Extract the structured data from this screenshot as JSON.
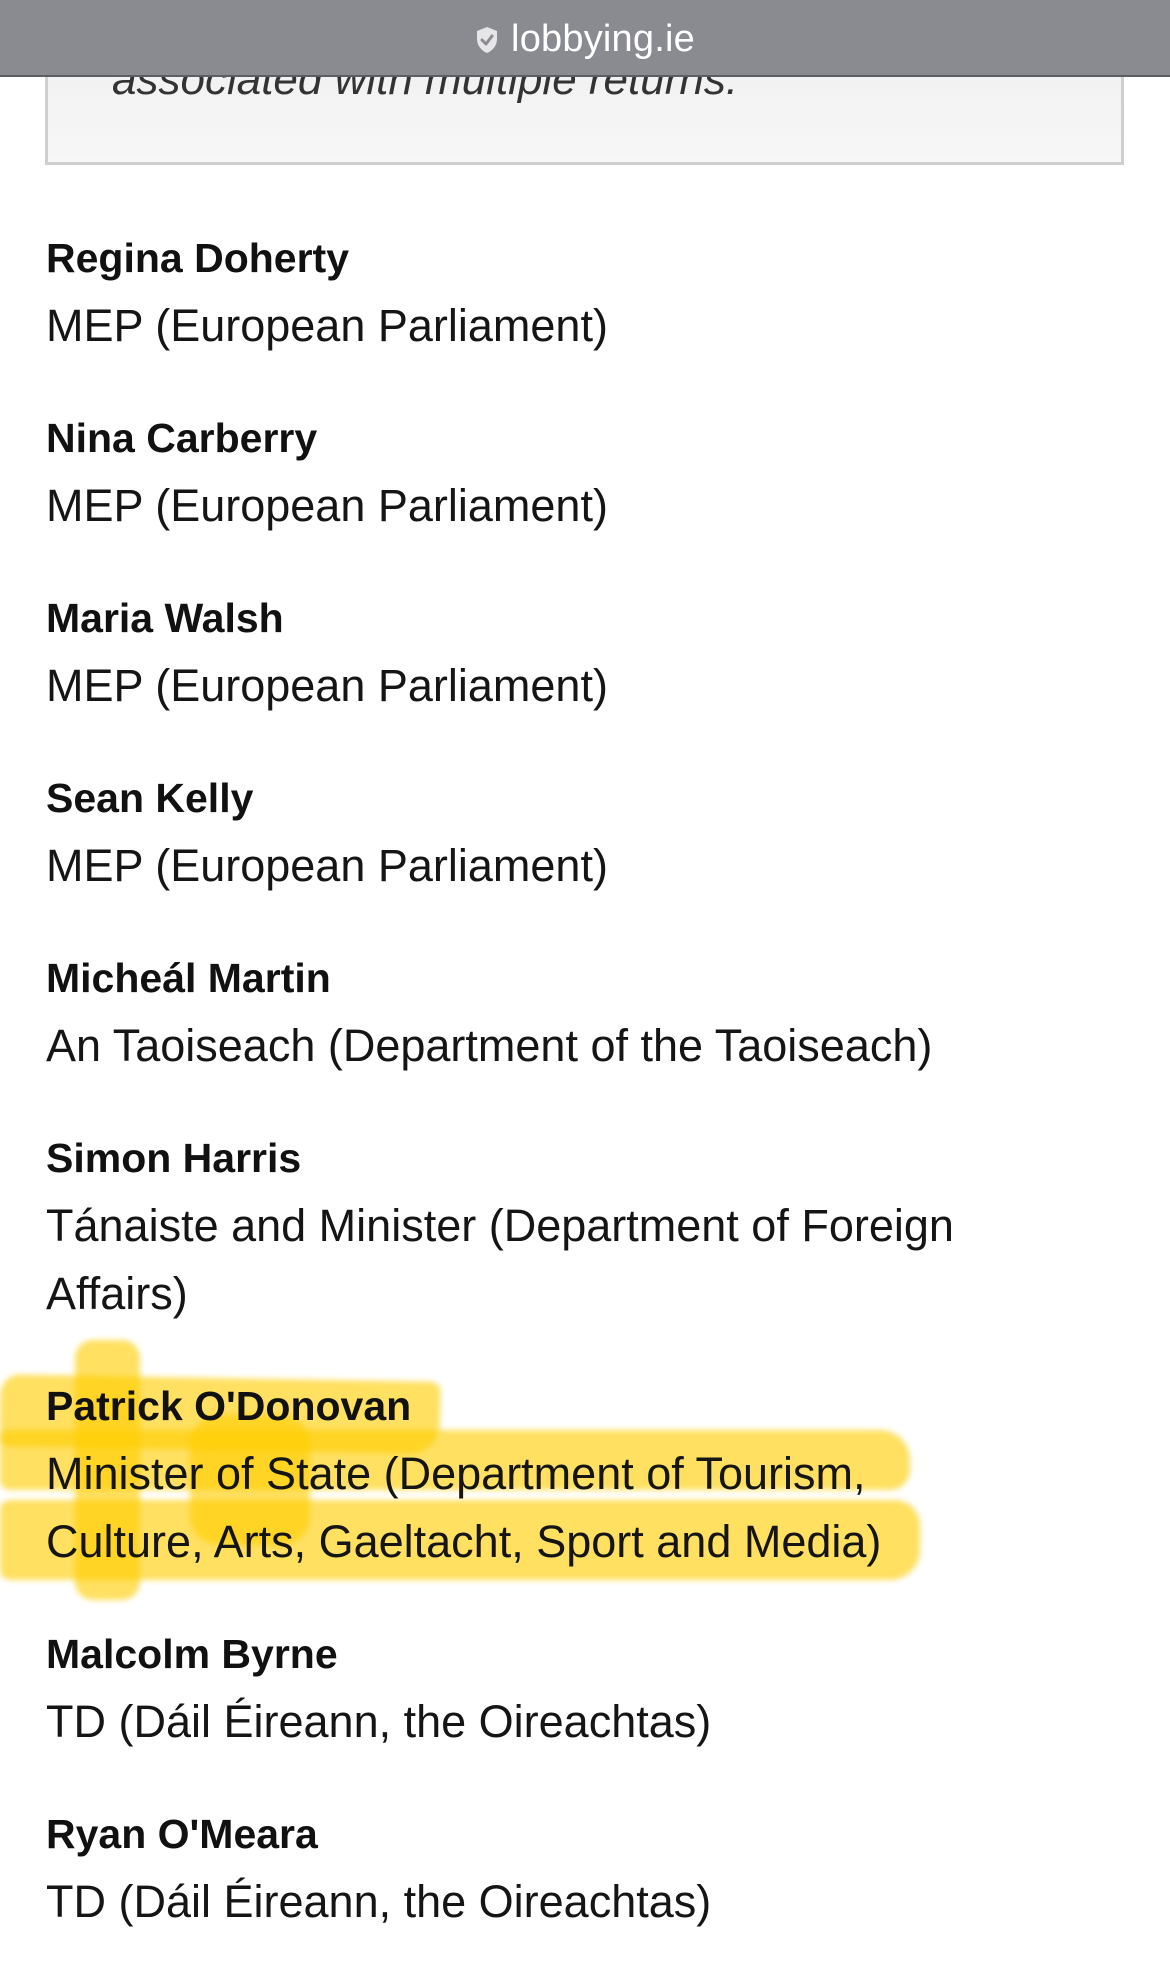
{
  "browser": {
    "domain": "lobbying.ie"
  },
  "notice": {
    "text": "associated with multiple returns."
  },
  "officials": [
    {
      "name": "Regina Doherty",
      "role": "MEP (European Parliament)"
    },
    {
      "name": "Nina Carberry",
      "role": "MEP (European Parliament)"
    },
    {
      "name": "Maria Walsh",
      "role": "MEP (European Parliament)"
    },
    {
      "name": "Sean Kelly",
      "role": "MEP (European Parliament)"
    },
    {
      "name": "Micheál Martin",
      "role": "An Taoiseach (Department of the Taoiseach)"
    },
    {
      "name": "Simon Harris",
      "role": "Tánaiste and Minister (Department of Foreign Affairs)"
    },
    {
      "name": "Patrick O'Donovan",
      "role": "Minister of State (Department of Tourism, Culture, Arts, Gaeltacht, Sport and Media)"
    },
    {
      "name": "Malcolm Byrne",
      "role": "TD (Dáil Éireann, the Oireachtas)"
    },
    {
      "name": "Ryan O'Meara",
      "role": "TD (Dáil Éireann, the Oireachtas)"
    }
  ],
  "colors": {
    "highlight": "#ffcd00",
    "url_bar": "#8a8b90"
  }
}
